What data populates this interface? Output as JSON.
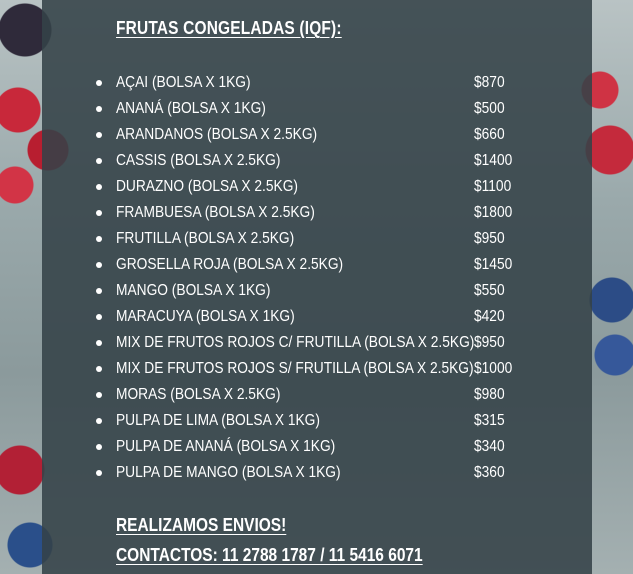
{
  "title": "FRUTAS CONGELADAS (IQF):",
  "items": [
    {
      "name": "AÇAI (BOLSA X 1KG)",
      "price": "$870"
    },
    {
      "name": "ANANÁ (BOLSA X 1KG)",
      "price": "$500"
    },
    {
      "name": "ARANDANOS (BOLSA X 2.5KG)",
      "price": "$660"
    },
    {
      "name": "CASSIS (BOLSA X 2.5KG)",
      "price": "$1400"
    },
    {
      "name": "DURAZNO (BOLSA X 2.5KG)",
      "price": "$1100"
    },
    {
      "name": "FRAMBUESA (BOLSA X 2.5KG)",
      "price": "$1800"
    },
    {
      "name": "FRUTILLA (BOLSA X 2.5KG)",
      "price": "$950"
    },
    {
      "name": "GROSELLA ROJA (BOLSA X 2.5KG)",
      "price": "$1450"
    },
    {
      "name": "MANGO (BOLSA X 1KG)",
      "price": "$550"
    },
    {
      "name": "MARACUYA (BOLSA X 1KG)",
      "price": "$420"
    },
    {
      "name": "MIX DE FRUTOS ROJOS C/ FRUTILLA (BOLSA X 2.5KG)",
      "price": "$950"
    },
    {
      "name": "MIX DE FRUTOS ROJOS S/ FRUTILLA (BOLSA X 2.5KG)",
      "price": "$1000"
    },
    {
      "name": "MORAS (BOLSA X 2.5KG)",
      "price": "$980"
    },
    {
      "name": "PULPA DE LIMA (BOLSA X 1KG)",
      "price": "$315"
    },
    {
      "name": "PULPA DE ANANÁ (BOLSA X 1KG)",
      "price": "$340"
    },
    {
      "name": "PULPA DE MANGO (BOLSA X 1KG)",
      "price": "$360"
    }
  ],
  "footer": {
    "shipping": "REALIZAMOS ENVIOS!",
    "contacts": "CONTACTOS: 11 2788 1787 / 11 5416 6071"
  },
  "colors": {
    "panel": "#344248",
    "text": "#ffffff"
  }
}
